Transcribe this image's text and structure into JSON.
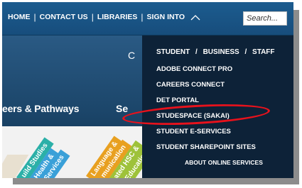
{
  "nav": {
    "items": [
      "HOME",
      "CONTACT US",
      "LIBRARIES",
      "SIGN INTO"
    ],
    "separator": "|",
    "sign_into_chevron": "chevron-up-icon"
  },
  "search": {
    "placeholder": "Search..."
  },
  "background": {
    "partial_heading_c": "C",
    "section_careers": "eers & Pathways",
    "section_se": "Se",
    "tiles": [
      "uild Studies",
      "Health &",
      "Services",
      "Language &",
      "munication",
      "ated HSC &",
      "Educatio"
    ]
  },
  "dropdown": {
    "roles": [
      "STUDENT",
      "BUSINESS",
      "STAFF"
    ],
    "role_separator": "/",
    "links": [
      "ADOBE CONNECT PRO",
      "CAREERS CONNECT",
      "DET PORTAL",
      "STUDESPACE (SAKAI)",
      "STUDENT E-SERVICES",
      "STUDENT SHAREPOINT SITES",
      "ABOUT ONLINE SERVICES"
    ],
    "highlighted": "STUDESPACE (SAKAI)"
  },
  "colors": {
    "topbar": "#1c5c8f",
    "dropdown_bg": "#0d2238",
    "highlight": "#e8121c",
    "shadow": "#8c8c8c"
  }
}
